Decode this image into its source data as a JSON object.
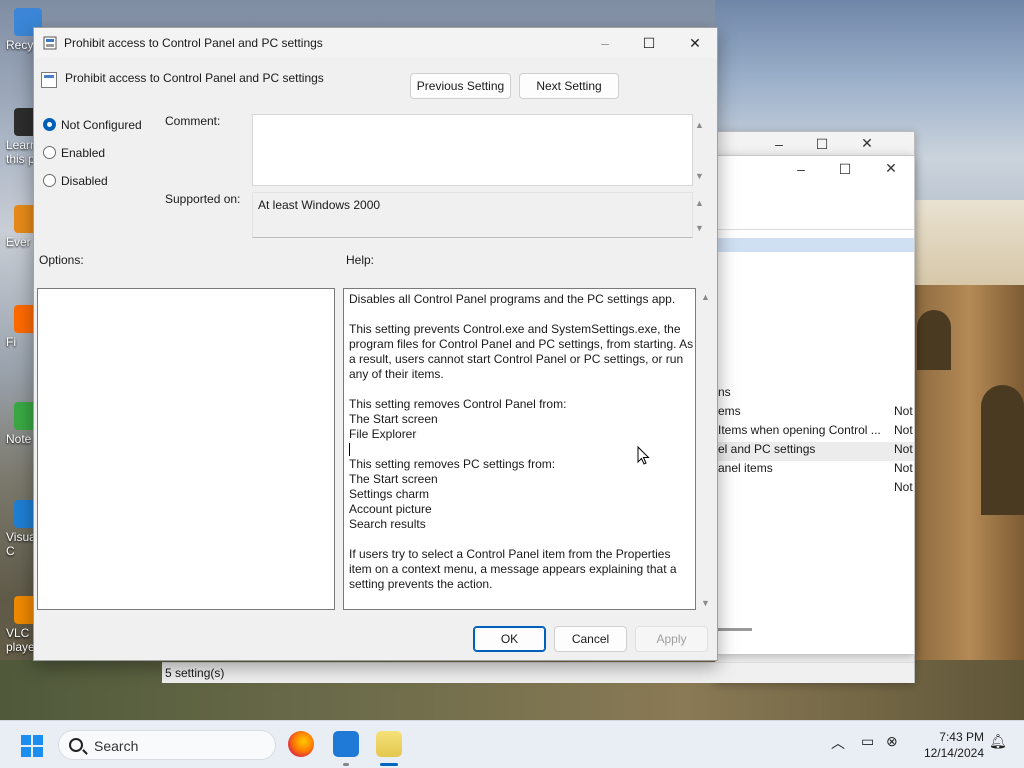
{
  "desktop": {
    "icons": [
      {
        "label": "Recy",
        "color": "#3b86d6"
      },
      {
        "label": "Learn\nthis p",
        "color": "#2d2d2d"
      },
      {
        "label": "Ever",
        "color": "#e88a1a"
      },
      {
        "label": "Fi",
        "color": "#ff6a00"
      },
      {
        "label": "Note",
        "color": "#3aa844"
      },
      {
        "label": "Visua\nC",
        "color": "#1f7fd3"
      },
      {
        "label": "VLC\nplayer",
        "color": "#f08a00"
      }
    ]
  },
  "background_window": {
    "list_rows": [
      {
        "label": "ns",
        "status": ""
      },
      {
        "label": "ems",
        "status": "Not"
      },
      {
        "label": "Items when opening Control ...",
        "status": "Not"
      },
      {
        "label": "el and PC settings",
        "status": "Not"
      },
      {
        "label": "anel items",
        "status": "Not"
      },
      {
        "label": "",
        "status": "Not"
      }
    ],
    "status_text": "5 setting(s)"
  },
  "dialog": {
    "window_title": "Prohibit access to Control Panel and PC settings",
    "heading": "Prohibit access to Control Panel and PC settings",
    "previous_setting": "Previous Setting",
    "next_setting": "Next Setting",
    "state_options": [
      {
        "label": "Not Configured",
        "selected": true
      },
      {
        "label": "Enabled",
        "selected": false
      },
      {
        "label": "Disabled",
        "selected": false
      }
    ],
    "comment_label": "Comment:",
    "comment_value": "",
    "supported_on_label": "Supported on:",
    "supported_on_value": "At least Windows 2000",
    "options_label": "Options:",
    "help_label": "Help:",
    "help_lines": [
      "Disables all Control Panel programs and the PC settings app.",
      "This setting prevents Control.exe and SystemSettings.exe, the program files for Control Panel and PC settings, from starting. As a result, users cannot start Control Panel or PC settings, or run any of their items.",
      "This setting removes Control Panel from:",
      "The Start screen",
      "File Explorer",
      "This setting removes PC settings from:",
      "The Start screen",
      "Settings charm",
      "Account picture",
      "Search results",
      "If users try to select a Control Panel item from the Properties item on a context menu, a message appears explaining that a setting prevents the action."
    ],
    "ok": "OK",
    "cancel": "Cancel",
    "apply": "Apply"
  },
  "taskbar": {
    "search_placeholder": "Search",
    "time": "7:43 PM",
    "date": "12/14/2024"
  },
  "colors": {
    "accent": "#005fb8",
    "dialog_bg": "#f0f0f0"
  }
}
